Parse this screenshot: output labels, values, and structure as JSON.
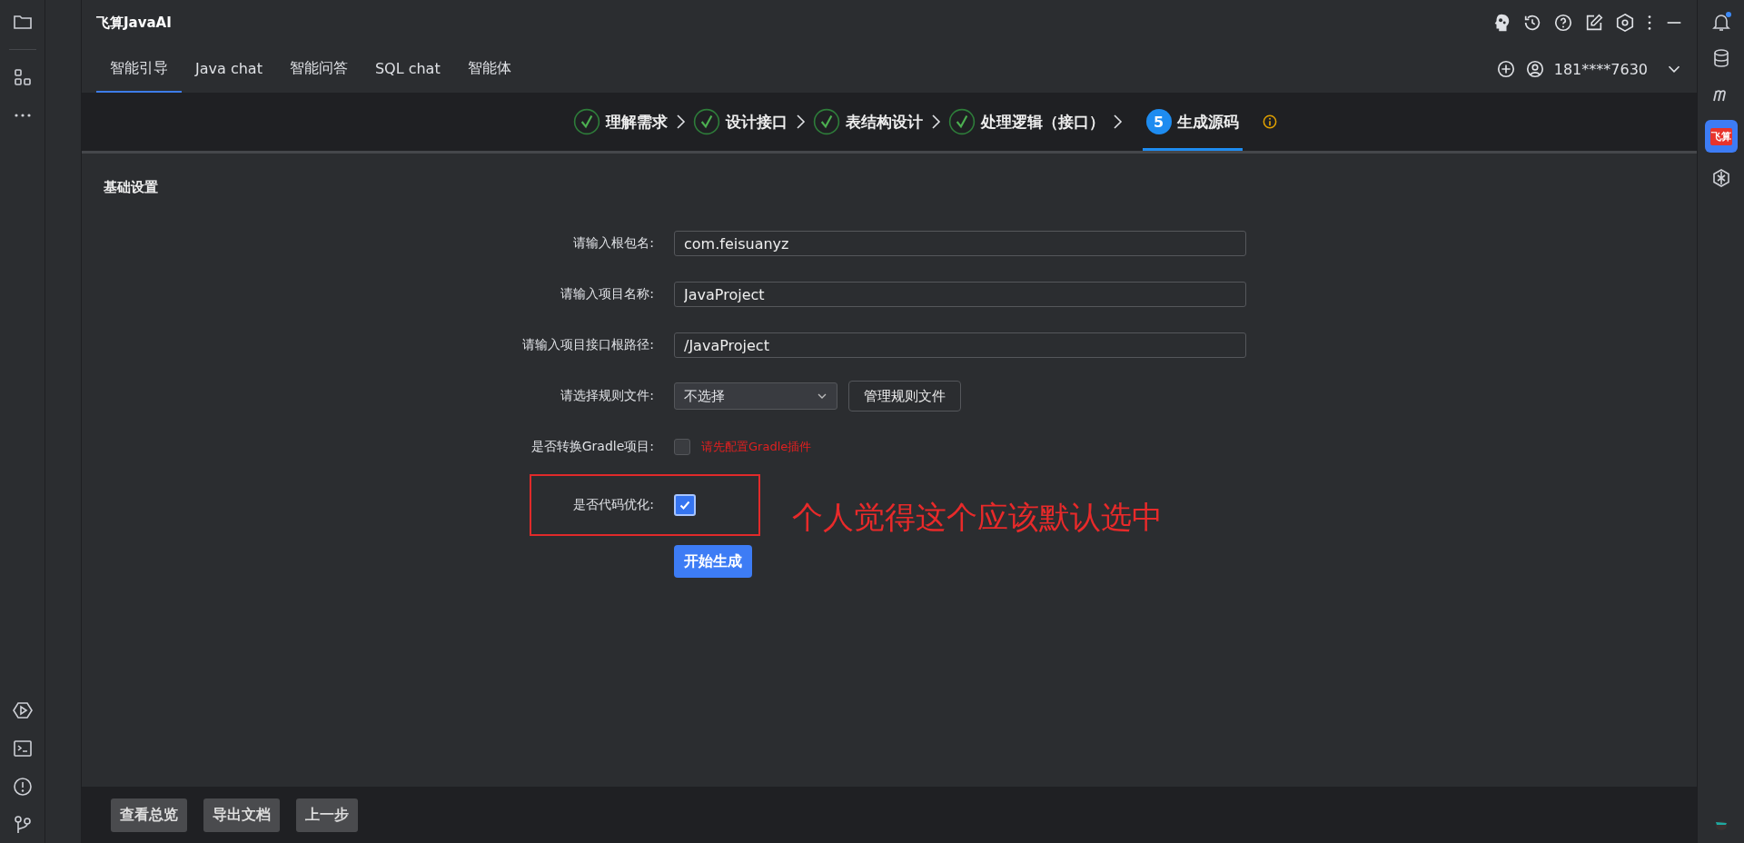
{
  "window": {
    "title": "飞算JavaAI"
  },
  "tabs": [
    {
      "label": "智能引导",
      "selected": true
    },
    {
      "label": "Java chat",
      "selected": false
    },
    {
      "label": "智能问答",
      "selected": false
    },
    {
      "label": "SQL chat",
      "selected": false
    },
    {
      "label": "智能体",
      "selected": false
    }
  ],
  "account": {
    "user": "181****7630"
  },
  "steps": [
    {
      "label": "理解需求",
      "done": true,
      "selected": false
    },
    {
      "label": "设计接口",
      "done": true,
      "selected": false
    },
    {
      "label": "表结构设计",
      "done": true,
      "selected": false
    },
    {
      "label": "处理逻辑（接口）",
      "done": true,
      "selected": false
    },
    {
      "label": "生成源码",
      "number": "5",
      "done": false,
      "selected": true
    }
  ],
  "section_title": "基础设置",
  "form": [
    {
      "kind": "input",
      "label": "请输入根包名:",
      "value": "com.feisuanyz"
    },
    {
      "kind": "input",
      "label": "请输入项目名称:",
      "value": "JavaProject"
    },
    {
      "kind": "input",
      "label": "请输入项目接口根路径:",
      "value": "/JavaProject"
    },
    {
      "kind": "select",
      "label": "请选择规则文件:",
      "value": "不选择",
      "button": "管理规则文件"
    },
    {
      "kind": "checkbox",
      "label": "是否转换Gradle项目:",
      "checked": false,
      "hint": "请先配置Gradle插件",
      "highlighted": false
    },
    {
      "kind": "checkbox",
      "label": "是否代码优化:",
      "checked": true,
      "highlighted": true
    }
  ],
  "generate_button": "开始生成",
  "annotation": "个人觉得这个应该默认选中",
  "footer_buttons": [
    "查看总览",
    "导出文档",
    "上一步"
  ],
  "right_sidebar": {
    "logo_text": "飞算",
    "notification": true
  }
}
